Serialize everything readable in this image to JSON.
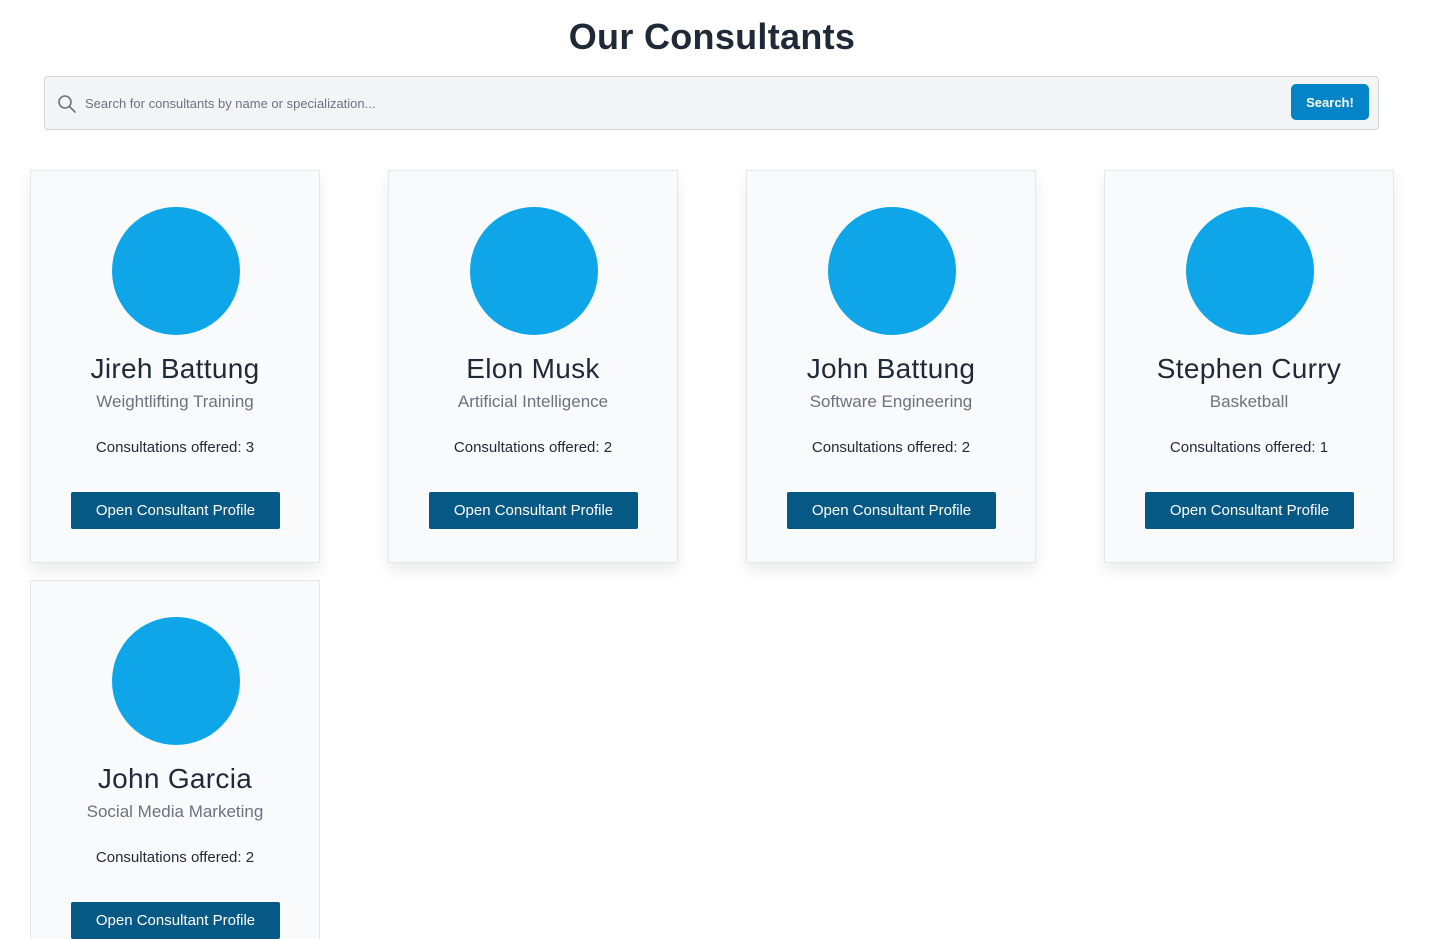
{
  "page": {
    "title": "Our Consultants"
  },
  "search": {
    "placeholder": "Search for consultants by name or specialization...",
    "button_label": "Search!"
  },
  "consultants": [
    {
      "name": "Jireh Battung",
      "specialization": "Weightlifting Training",
      "consultations": "Consultations offered: 3",
      "button_label": "Open Consultant Profile"
    },
    {
      "name": "Elon Musk",
      "specialization": "Artificial Intelligence",
      "consultations": "Consultations offered: 2",
      "button_label": "Open Consultant Profile"
    },
    {
      "name": "John Battung",
      "specialization": "Software Engineering",
      "consultations": "Consultations offered: 2",
      "button_label": "Open Consultant Profile"
    },
    {
      "name": "Stephen Curry",
      "specialization": "Basketball",
      "consultations": "Consultations offered: 1",
      "button_label": "Open Consultant Profile"
    },
    {
      "name": "John Garcia",
      "specialization": "Social Media Marketing",
      "consultations": "Consultations offered: 2",
      "button_label": "Open Consultant Profile"
    }
  ],
  "colors": {
    "avatar": "#0ea5e9",
    "primary_button": "#075985",
    "search_button": "#0284c7"
  }
}
